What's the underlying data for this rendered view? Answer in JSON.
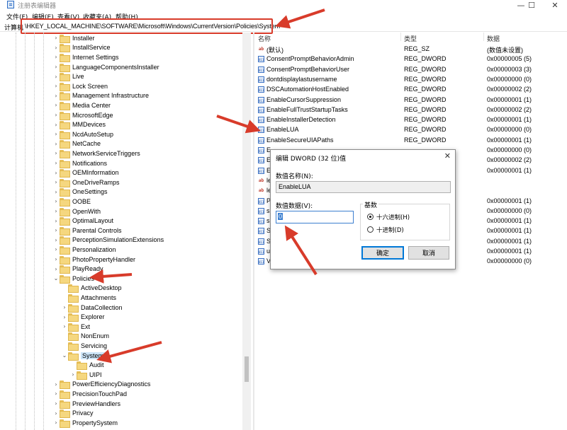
{
  "window": {
    "title": "注册表编辑器",
    "controls": {
      "minimize": "—",
      "maximize": "☐",
      "close": "✕"
    }
  },
  "menu": [
    "文件(F)",
    "编辑(E)",
    "查看(V)",
    "收藏夹(A)",
    "帮助(H)"
  ],
  "address": {
    "label": "计算机",
    "path": "\\HKEY_LOCAL_MACHINE\\SOFTWARE\\Microsoft\\Windows\\CurrentVersion\\Policies\\System"
  },
  "tree": [
    {
      "label": "Installer",
      "depth": 0,
      "expandable": true
    },
    {
      "label": "InstallService",
      "depth": 0,
      "expandable": true
    },
    {
      "label": "Internet Settings",
      "depth": 0,
      "expandable": true
    },
    {
      "label": "LanguageComponentsInstaller",
      "depth": 0,
      "expandable": true
    },
    {
      "label": "Live",
      "depth": 0,
      "expandable": true
    },
    {
      "label": "Lock Screen",
      "depth": 0,
      "expandable": true
    },
    {
      "label": "Management Infrastructure",
      "depth": 0,
      "expandable": true
    },
    {
      "label": "Media Center",
      "depth": 0,
      "expandable": true
    },
    {
      "label": "MicrosoftEdge",
      "depth": 0,
      "expandable": true
    },
    {
      "label": "MMDevices",
      "depth": 0,
      "expandable": true
    },
    {
      "label": "NcdAutoSetup",
      "depth": 0,
      "expandable": true
    },
    {
      "label": "NetCache",
      "depth": 0,
      "expandable": true
    },
    {
      "label": "NetworkServiceTriggers",
      "depth": 0,
      "expandable": true
    },
    {
      "label": "Notifications",
      "depth": 0,
      "expandable": true
    },
    {
      "label": "OEMInformation",
      "depth": 0,
      "expandable": true
    },
    {
      "label": "OneDriveRamps",
      "depth": 0,
      "expandable": true
    },
    {
      "label": "OneSettings",
      "depth": 0,
      "expandable": true
    },
    {
      "label": "OOBE",
      "depth": 0,
      "expandable": true
    },
    {
      "label": "OpenWith",
      "depth": 0,
      "expandable": true
    },
    {
      "label": "OptimalLayout",
      "depth": 0,
      "expandable": true
    },
    {
      "label": "Parental Controls",
      "depth": 0,
      "expandable": true
    },
    {
      "label": "PerceptionSimulationExtensions",
      "depth": 0,
      "expandable": true
    },
    {
      "label": "Personalization",
      "depth": 0,
      "expandable": true
    },
    {
      "label": "PhotoPropertyHandler",
      "depth": 0,
      "expandable": true
    },
    {
      "label": "PlayReady",
      "depth": 0,
      "expandable": true
    },
    {
      "label": "Policies",
      "depth": 0,
      "expanded": true
    },
    {
      "label": "ActiveDesktop",
      "depth": 1,
      "expandable": false
    },
    {
      "label": "Attachments",
      "depth": 1,
      "expandable": false
    },
    {
      "label": "DataCollection",
      "depth": 1,
      "expandable": true
    },
    {
      "label": "Explorer",
      "depth": 1,
      "expandable": true
    },
    {
      "label": "Ext",
      "depth": 1,
      "expandable": true
    },
    {
      "label": "NonEnum",
      "depth": 1,
      "expandable": false
    },
    {
      "label": "Servicing",
      "depth": 1,
      "expandable": false
    },
    {
      "label": "System",
      "depth": 1,
      "expanded": true,
      "selected": true
    },
    {
      "label": "Audit",
      "depth": 2,
      "expandable": false
    },
    {
      "label": "UIPI",
      "depth": 2,
      "expandable": true
    },
    {
      "label": "PowerEfficiencyDiagnostics",
      "depth": 0,
      "expandable": true
    },
    {
      "label": "PrecisionTouchPad",
      "depth": 0,
      "expandable": true
    },
    {
      "label": "PreviewHandlers",
      "depth": 0,
      "expandable": true
    },
    {
      "label": "Privacy",
      "depth": 0,
      "expandable": true
    },
    {
      "label": "PropertySystem",
      "depth": 0,
      "expandable": true
    }
  ],
  "columns": {
    "name": "名称",
    "type": "类型",
    "data": "数据"
  },
  "values": [
    {
      "name": "(默认)",
      "type": "REG_SZ",
      "data": "(数值未设置)",
      "kind": "sz"
    },
    {
      "name": "ConsentPromptBehaviorAdmin",
      "type": "REG_DWORD",
      "data": "0x00000005 (5)",
      "kind": "dw"
    },
    {
      "name": "ConsentPromptBehaviorUser",
      "type": "REG_DWORD",
      "data": "0x00000003 (3)",
      "kind": "dw"
    },
    {
      "name": "dontdisplaylastusername",
      "type": "REG_DWORD",
      "data": "0x00000000 (0)",
      "kind": "dw"
    },
    {
      "name": "DSCAutomationHostEnabled",
      "type": "REG_DWORD",
      "data": "0x00000002 (2)",
      "kind": "dw"
    },
    {
      "name": "EnableCursorSuppression",
      "type": "REG_DWORD",
      "data": "0x00000001 (1)",
      "kind": "dw"
    },
    {
      "name": "EnableFullTrustStartupTasks",
      "type": "REG_DWORD",
      "data": "0x00000002 (2)",
      "kind": "dw"
    },
    {
      "name": "EnableInstallerDetection",
      "type": "REG_DWORD",
      "data": "0x00000001 (1)",
      "kind": "dw"
    },
    {
      "name": "EnableLUA",
      "type": "REG_DWORD",
      "data": "0x00000000 (0)",
      "kind": "dw"
    },
    {
      "name": "EnableSecureUIAPaths",
      "type": "REG_DWORD",
      "data": "0x00000001 (1)",
      "kind": "dw"
    },
    {
      "name": "E",
      "type": "",
      "data": "0x00000000 (0)",
      "kind": "dw"
    },
    {
      "name": "E",
      "type": "",
      "data": "0x00000002 (2)",
      "kind": "dw"
    },
    {
      "name": "E",
      "type": "",
      "data": "0x00000001 (1)",
      "kind": "dw"
    },
    {
      "name": "le",
      "type": "",
      "data": "",
      "kind": "sz"
    },
    {
      "name": "le",
      "type": "",
      "data": "",
      "kind": "sz"
    },
    {
      "name": "P",
      "type": "",
      "data": "0x00000001 (1)",
      "kind": "dw"
    },
    {
      "name": "s",
      "type": "",
      "data": "0x00000000 (0)",
      "kind": "dw"
    },
    {
      "name": "s",
      "type": "",
      "data": "0x00000001 (1)",
      "kind": "dw"
    },
    {
      "name": "S",
      "type": "",
      "data": "0x00000001 (1)",
      "kind": "dw"
    },
    {
      "name": "S",
      "type": "",
      "data": "0x00000001 (1)",
      "kind": "dw"
    },
    {
      "name": "u",
      "type": "",
      "data": "0x00000001 (1)",
      "kind": "dw"
    },
    {
      "name": "V",
      "type": "",
      "data": "0x00000000 (0)",
      "kind": "dw"
    }
  ],
  "dialog": {
    "title": "编辑 DWORD (32 位)值",
    "close": "✕",
    "name_label": "数值名称(N):",
    "name_value": "EnableLUA",
    "data_label": "数值数据(V):",
    "data_value": "0",
    "base_label": "基数",
    "radio_hex": "十六进制(H)",
    "radio_dec": "十进制(D)",
    "selected_base": "hex",
    "ok": "确定",
    "cancel": "取消"
  },
  "colors": {
    "annotation_red": "#d83b2a",
    "selection_blue": "#cce4f7",
    "focus_blue": "#0078d7"
  }
}
